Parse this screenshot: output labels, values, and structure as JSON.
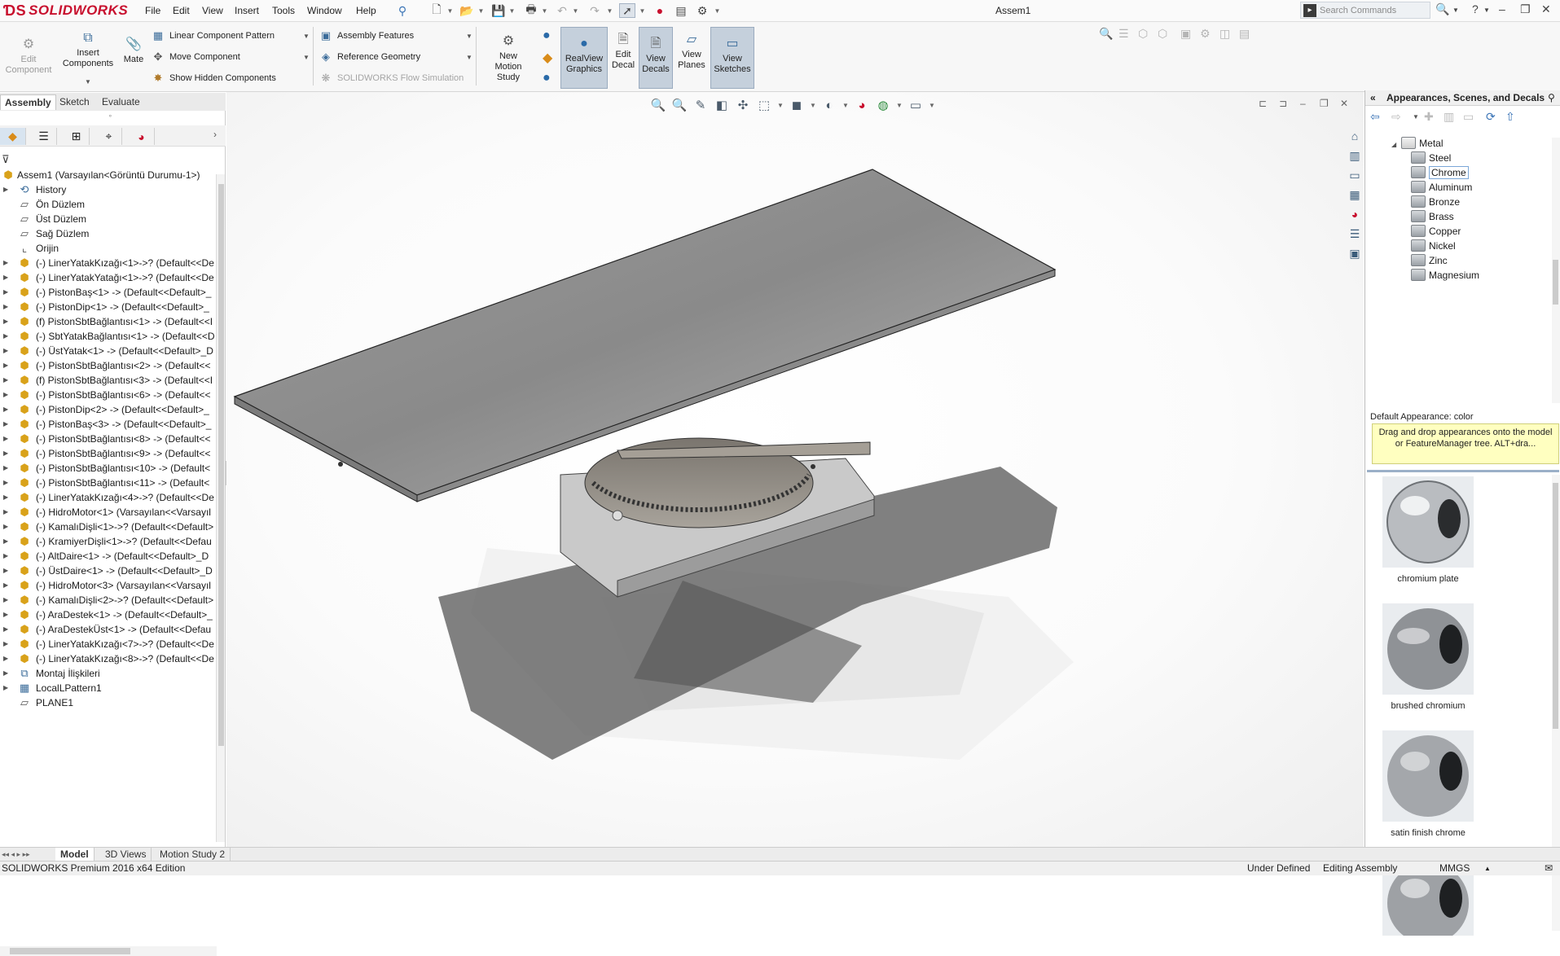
{
  "app": {
    "brand": "SOLIDWORKS",
    "document_title": "Assem1"
  },
  "menu": [
    "File",
    "Edit",
    "View",
    "Insert",
    "Tools",
    "Window",
    "Help"
  ],
  "search": {
    "placeholder": "Search Commands"
  },
  "ribbon": {
    "edit_component": "Edit\nComponent",
    "insert_components": "Insert\nComponents",
    "mate": "Mate",
    "linear_component_pattern": "Linear Component Pattern",
    "move_component": "Move Component",
    "show_hidden_components": "Show Hidden Components",
    "assembly_features": "Assembly Features",
    "reference_geometry": "Reference Geometry",
    "flow_simulation": "SOLIDWORKS Flow Simulation",
    "new_motion_study": "New\nMotion\nStudy",
    "realview_graphics": "RealView\nGraphics",
    "edit_decal": "Edit\nDecal",
    "view_decals": "View\nDecals",
    "view_planes": "View\nPlanes",
    "view_sketches": "View\nSketches"
  },
  "command_tabs": [
    "Assembly",
    "Sketch",
    "Evaluate"
  ],
  "feature_tree": {
    "root": "Assem1  (Varsayılan<Görüntü Durumu-1>)",
    "items": [
      {
        "label": "History",
        "icon": "history-icon"
      },
      {
        "label": "Ön Düzlem",
        "icon": "plane-icon"
      },
      {
        "label": "Üst Düzlem",
        "icon": "plane-icon"
      },
      {
        "label": "Sağ Düzlem",
        "icon": "plane-icon"
      },
      {
        "label": "Orijin",
        "icon": "origin-icon"
      },
      {
        "label": "(-) LinerYatakKızağı<1>->? (Default<<De",
        "icon": "part-icon"
      },
      {
        "label": "(-) LinerYatakYatağı<1>->? (Default<<De",
        "icon": "part-icon"
      },
      {
        "label": "(-) PistonBaş<1> -> (Default<<Default>_",
        "icon": "part-icon"
      },
      {
        "label": "(-) PistonDip<1> -> (Default<<Default>_",
        "icon": "part-icon"
      },
      {
        "label": "(f) PistonSbtBağlantısı<1> -> (Default<<I",
        "icon": "part-icon"
      },
      {
        "label": "(-) SbtYatakBağlantısı<1> -> (Default<<D",
        "icon": "part-icon"
      },
      {
        "label": "(-) ÜstYatak<1> -> (Default<<Default>_D",
        "icon": "part-icon"
      },
      {
        "label": "(-) PistonSbtBağlantısı<2> -> (Default<<",
        "icon": "part-icon"
      },
      {
        "label": "(f) PistonSbtBağlantısı<3> -> (Default<<I",
        "icon": "part-icon"
      },
      {
        "label": "(-) PistonSbtBağlantısı<6> -> (Default<<",
        "icon": "part-icon"
      },
      {
        "label": "(-) PistonDip<2> -> (Default<<Default>_",
        "icon": "part-icon"
      },
      {
        "label": "(-) PistonBaş<3> -> (Default<<Default>_",
        "icon": "part-icon"
      },
      {
        "label": "(-) PistonSbtBağlantısı<8> -> (Default<<",
        "icon": "part-icon"
      },
      {
        "label": "(-) PistonSbtBağlantısı<9> -> (Default<<",
        "icon": "part-icon"
      },
      {
        "label": "(-) PistonSbtBağlantısı<10> -> (Default<",
        "icon": "part-icon"
      },
      {
        "label": "(-) PistonSbtBağlantısı<11> -> (Default<",
        "icon": "part-icon"
      },
      {
        "label": "(-) LinerYatakKızağı<4>->? (Default<<De",
        "icon": "part-icon"
      },
      {
        "label": "(-) HidroMotor<1> (Varsayılan<<Varsayıl",
        "icon": "part-icon"
      },
      {
        "label": "(-) KamalıDişli<1>->? (Default<<Default>",
        "icon": "part-icon"
      },
      {
        "label": "(-) KramiyerDişli<1>->? (Default<<Defau",
        "icon": "part-icon"
      },
      {
        "label": "(-) AltDaire<1> -> (Default<<Default>_D",
        "icon": "part-icon"
      },
      {
        "label": "(-) ÜstDaire<1> -> (Default<<Default>_D",
        "icon": "part-icon"
      },
      {
        "label": "(-) HidroMotor<3> (Varsayılan<<Varsayıl",
        "icon": "part-icon"
      },
      {
        "label": "(-) KamalıDişli<2>->? (Default<<Default>",
        "icon": "part-icon"
      },
      {
        "label": "(-) AraDestek<1> -> (Default<<Default>_",
        "icon": "part-icon"
      },
      {
        "label": "(-) AraDestekÜst<1> -> (Default<<Defau",
        "icon": "part-icon"
      },
      {
        "label": "(-) LinerYatakKızağı<7>->? (Default<<De",
        "icon": "part-icon"
      },
      {
        "label": "(-) LinerYatakKızağı<8>->? (Default<<De",
        "icon": "part-icon"
      },
      {
        "label": "Montaj İlişkileri",
        "icon": "mates-icon"
      },
      {
        "label": "LocalLPattern1",
        "icon": "pattern-icon"
      },
      {
        "label": "PLANE1",
        "icon": "plane-icon"
      }
    ]
  },
  "bottom_tabs": [
    "Model",
    "3D Views",
    "Motion Study 2"
  ],
  "status": {
    "edition": "SOLIDWORKS Premium 2016 x64 Edition",
    "defined": "Under Defined",
    "mode": "Editing Assembly",
    "units": "MMGS"
  },
  "appearances": {
    "title": "Appearances, Scenes, and Decals",
    "folder": "Metal",
    "items": [
      "Steel",
      "Chrome",
      "Aluminum",
      "Bronze",
      "Brass",
      "Copper",
      "Nickel",
      "Zinc",
      "Magnesium"
    ],
    "selected": "Chrome",
    "default_label": "Default Appearance: color",
    "tip": "Drag and drop appearances onto the model or FeatureManager tree.  ALT+dra...",
    "swatches": [
      "chromium plate",
      "brushed chromium",
      "satin finish chrome",
      ""
    ]
  },
  "colors": {
    "brand_red": "#c8102e",
    "active_button": "#c5d0dc",
    "tooltip_bg": "#ffffc0"
  }
}
